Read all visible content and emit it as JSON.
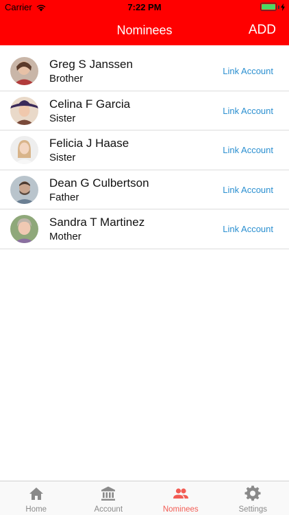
{
  "status_bar": {
    "carrier": "Carrier",
    "time": "7:22 PM"
  },
  "nav": {
    "title": "Nominees",
    "add_label": "ADD"
  },
  "nominees": [
    {
      "name": "Greg S Janssen",
      "relation": "Brother",
      "link_label": "Link Account"
    },
    {
      "name": "Celina F Garcia",
      "relation": "Sister",
      "link_label": "Link Account"
    },
    {
      "name": "Felicia J Haase",
      "relation": "Sister",
      "link_label": "Link Account"
    },
    {
      "name": "Dean G Culbertson",
      "relation": "Father",
      "link_label": "Link Account"
    },
    {
      "name": "Sandra T Martinez",
      "relation": "Mother",
      "link_label": "Link Account"
    }
  ],
  "tabs": [
    {
      "label": "Home",
      "icon": "home-icon",
      "active": false
    },
    {
      "label": "Account",
      "icon": "bank-icon",
      "active": false
    },
    {
      "label": "Nominees",
      "icon": "people-icon",
      "active": true
    },
    {
      "label": "Settings",
      "icon": "gear-icon",
      "active": false
    }
  ],
  "colors": {
    "brand": "#ff0000",
    "link": "#2a8fd0",
    "tab_active": "#f25c54",
    "tab_inactive": "#8a8a8a"
  }
}
